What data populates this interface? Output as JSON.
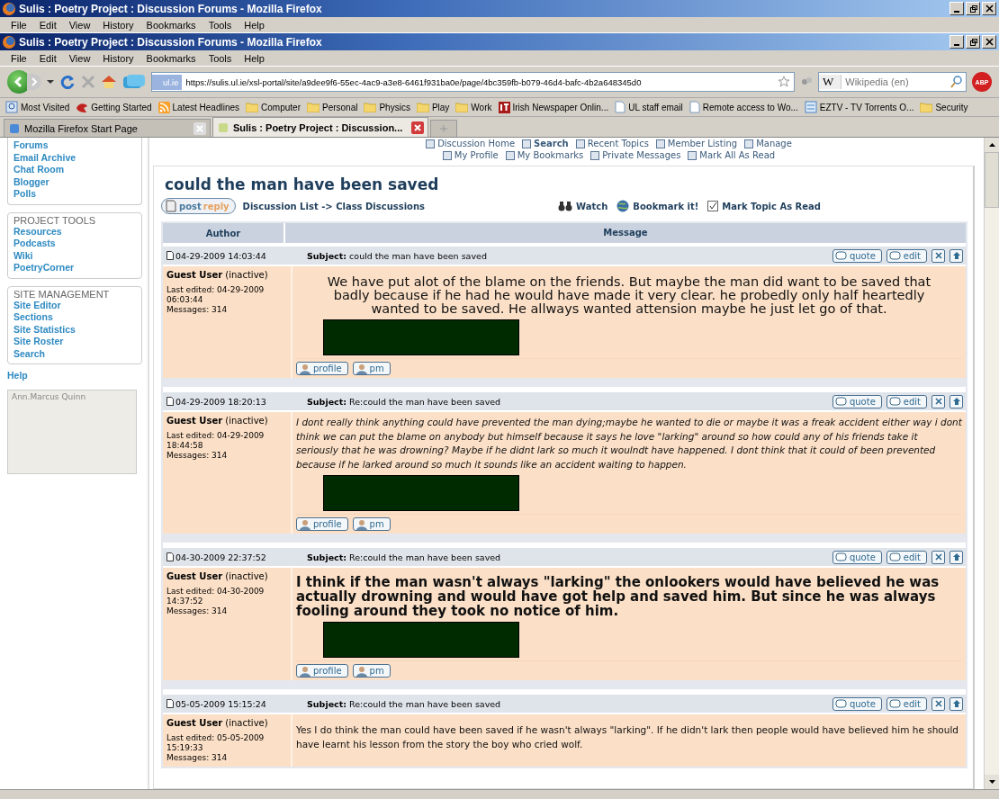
{
  "windows": [
    {
      "title": "Sulis : Poetry Project : Discussion Forums - Mozilla Firefox",
      "menu": [
        "File",
        "Edit",
        "View",
        "History",
        "Bookmarks",
        "Tools",
        "Help"
      ]
    },
    {
      "title": "Sulis : Poetry Project : Discussion Forums - Mozilla Firefox",
      "menu": [
        "File",
        "Edit",
        "View",
        "History",
        "Bookmarks",
        "Tools",
        "Help"
      ]
    }
  ],
  "address_bar": {
    "site_label": "ul.ie",
    "url": "https://sulis.ul.ie/xsl-portal/site/a9dee9f6-55ec-4ac9-a3e8-6461f931ba0e/page/4bc359fb-b079-46d4-bafc-4b2a648345d0"
  },
  "search": {
    "engine": "W",
    "placeholder": "Wikipedia (en)"
  },
  "addon_button": "ABP",
  "bookmarks": [
    {
      "label": "Most Visited",
      "kind": "smart"
    },
    {
      "label": "Getting Started",
      "kind": "site"
    },
    {
      "label": "Latest Headlines",
      "kind": "feed"
    },
    {
      "label": "Computer",
      "kind": "folder"
    },
    {
      "label": "Personal",
      "kind": "folder"
    },
    {
      "label": "Physics",
      "kind": "folder"
    },
    {
      "label": "Play",
      "kind": "folder"
    },
    {
      "label": "Work",
      "kind": "folder"
    },
    {
      "label": "Irish Newspaper Onlin...",
      "kind": "news"
    },
    {
      "label": "UL staff email",
      "kind": "page"
    },
    {
      "label": "Remote access to Wo...",
      "kind": "page"
    },
    {
      "label": "EZTV - TV Torrents O...",
      "kind": "tv"
    },
    {
      "label": "Security",
      "kind": "folder"
    }
  ],
  "tabs": [
    {
      "label": "Mozilla Firefox Start Page",
      "selected": false
    },
    {
      "label": "Sulis : Poetry Project : Discussion...",
      "selected": true
    }
  ],
  "sidebar": {
    "sections": [
      {
        "items": [
          "Forums",
          "Email Archive",
          "Chat Room",
          "Blogger",
          "Polls"
        ]
      },
      {
        "heading": "PROJECT TOOLS",
        "items": [
          "Resources",
          "Podcasts",
          "Wiki",
          "PoetryCorner"
        ]
      },
      {
        "heading": "SITE MANAGEMENT",
        "items": [
          "Site Editor",
          "Sections",
          "Site Statistics",
          "Site Roster",
          "Search"
        ]
      }
    ],
    "help": "Help",
    "presence": "Ann.Marcus Quinn"
  },
  "forum_nav": [
    [
      {
        "label": "Discussion Home",
        "bold": false
      },
      {
        "label": "Search",
        "bold": true
      },
      {
        "label": "Recent Topics",
        "bold": false
      },
      {
        "label": "Member Listing",
        "bold": false
      },
      {
        "label": "Manage",
        "bold": false
      }
    ],
    [
      {
        "label": "My Profile",
        "bold": false
      },
      {
        "label": "My Bookmarks",
        "bold": false
      },
      {
        "label": "Private Messages",
        "bold": false
      },
      {
        "label": "Mark All As Read",
        "bold": false
      }
    ]
  ],
  "topic": {
    "title": "could the man have been saved",
    "post_reply": [
      "post",
      "reply"
    ],
    "breadcrumb": "Discussion List -> Class Discussions",
    "actions": [
      {
        "label": "Watch",
        "kind": "watch"
      },
      {
        "label": "Bookmark it!",
        "kind": "bookmark"
      },
      {
        "label": "Mark Topic As Read",
        "kind": "mark"
      }
    ]
  },
  "table": {
    "columns": [
      "Author",
      "Message"
    ],
    "posts": [
      {
        "date": "04-29-2009 14:03:44",
        "subject_label": "Subject:",
        "subject": "could the man have been saved",
        "author": "Guest User",
        "status": "(inactive)",
        "edited_label": "Last edited:",
        "edited_date": "04-29-2009",
        "edited_time": "06:03:44",
        "messages_label": "Messages:",
        "messages": "314",
        "kind": "large",
        "redacted": true,
        "body": "We have put alot of the blame on the friends. But maybe the man did want to be saved that badly because if he had he would have made it very clear. he probedly only half heartedly wanted to be saved. He allways wanted attension maybe he just let go of that.",
        "actions": [
          "quote",
          "edit"
        ],
        "user_buttons": [
          "profile",
          "pm"
        ]
      },
      {
        "date": "04-29-2009 18:20:13",
        "subject_label": "Subject:",
        "subject": "Re:could the man have been saved",
        "author": "Guest User",
        "status": "(inactive)",
        "edited_label": "Last edited:",
        "edited_date": "04-29-2009",
        "edited_time": "18:44:58",
        "messages_label": "Messages:",
        "messages": "314",
        "kind": "italic",
        "redacted": true,
        "body": "I dont really think anything could have prevented the man dying;maybe he wanted to die or maybe it was a freak accident either way i dont think we can put the blame on anybody but himself because it says he love \"larking\"  around so how could any of his friends take it seriously that he was drowning? Maybe if he didnt lark so much it woulndt have happened.  I dont think that it could of been prevented because if he larked around so much it sounds like an accident waiting to happen.",
        "actions": [
          "quote",
          "edit"
        ],
        "user_buttons": [
          "profile",
          "pm"
        ]
      },
      {
        "date": "04-30-2009 22:37:52",
        "subject_label": "Subject:",
        "subject": "Re:could the man have been saved",
        "author": "Guest User",
        "status": "(inactive)",
        "edited_label": "Last edited:",
        "edited_date": "04-30-2009",
        "edited_time": "14:37:52",
        "messages_label": "Messages:",
        "messages": "314",
        "kind": "bold",
        "redacted": true,
        "body": "I think if the man wasn't always \"larking\" the onlookers would have believed he was actually drowning and would have got help and saved him. But since he was always fooling around they took no notice of him.",
        "actions": [
          "quote",
          "edit"
        ],
        "user_buttons": [
          "profile",
          "pm"
        ]
      },
      {
        "date": "05-05-2009 15:15:24",
        "subject_label": "Subject:",
        "subject": "Re:could the man have been saved",
        "author": "Guest User",
        "status": "(inactive)",
        "edited_label": "Last edited:",
        "edited_date": "05-05-2009",
        "edited_time": "15:19:33",
        "messages_label": "Messages:",
        "messages": "314",
        "kind": "plain",
        "redacted": false,
        "body": "Yes I do think the man could have been saved if he wasn't always \"larking\". If he didn't lark then people would have believed him he should have learnt his lesson from the story the boy who cried wolf.",
        "actions": [
          "quote",
          "edit"
        ]
      }
    ]
  }
}
